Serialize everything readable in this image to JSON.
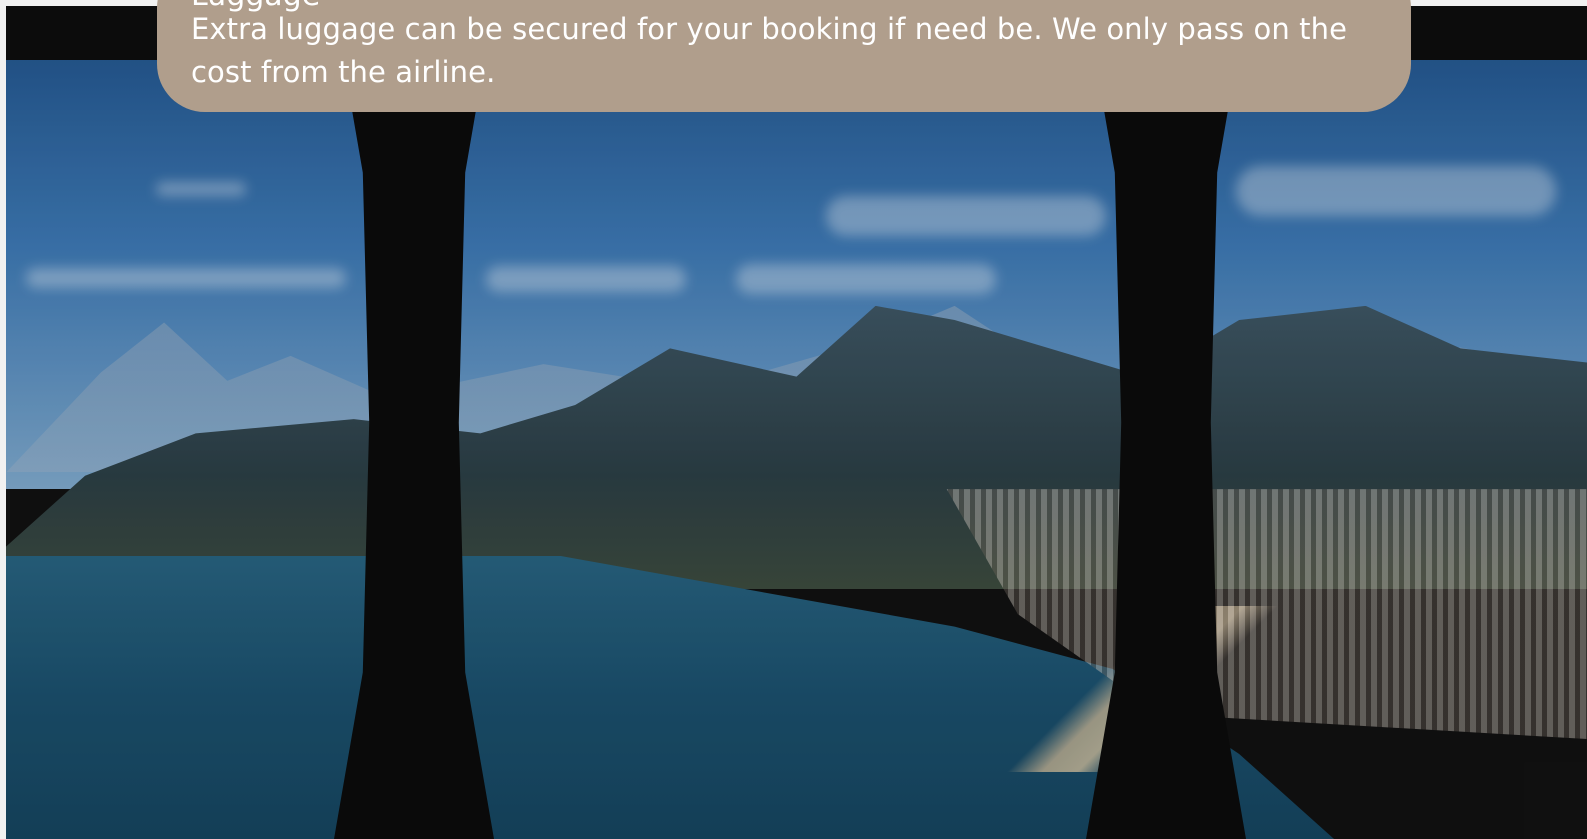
{
  "background": {
    "image_alt": "",
    "accent_color": "#b09e8c"
  },
  "info_card": {
    "heading": "Luggage",
    "body": "Extra luggage can be secured for your booking if need be. We only pass on the cost from the airline."
  }
}
